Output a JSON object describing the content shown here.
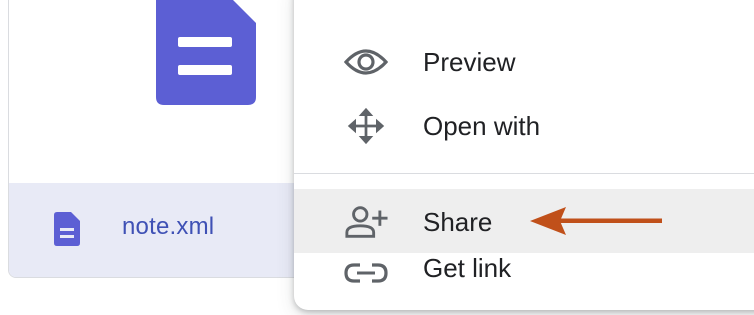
{
  "file": {
    "name": "note.xml",
    "type_icon": "document-icon"
  },
  "menu": {
    "items": [
      {
        "label": "Preview",
        "icon": "eye-icon"
      },
      {
        "label": "Open with",
        "icon": "move-arrows-icon"
      },
      {
        "label": "Share",
        "icon": "person-add-icon",
        "highlighted": true
      },
      {
        "label": "Get link",
        "icon": "link-icon"
      }
    ]
  },
  "colors": {
    "doc_icon": "#5c5fd4",
    "file_name": "#3f51b5",
    "footer_bg": "#e8eaf6",
    "highlight_bg": "#eeeeee",
    "annotation_arrow": "#c0501a"
  }
}
